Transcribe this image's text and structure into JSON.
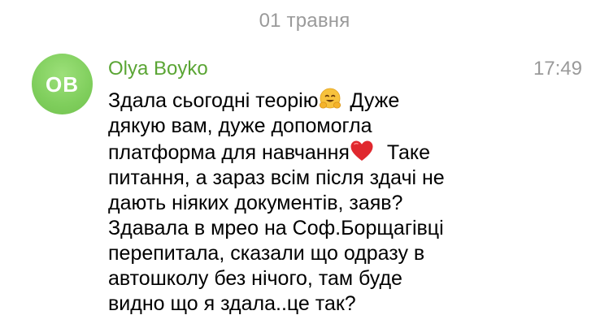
{
  "date_separator": "01 травня",
  "message": {
    "avatar_initials": "OB",
    "avatar_color": "#7fce5c",
    "sender_name": "Olya Boyko",
    "sender_color": "#5aa534",
    "time": "17:49",
    "lines": [
      {
        "before": "Здала сьогодні теорію",
        "emoji": "hugging-face-emoji",
        "after": " Дуже"
      },
      {
        "text": "дякую вам, дуже допомогла"
      },
      {
        "before": "платформа для навчання",
        "emoji": "red-heart-emoji",
        "after": "  Таке"
      },
      {
        "text": "питання, а зараз всім після здачі не"
      },
      {
        "text": "дають ніяких документів, заяв?"
      },
      {
        "text": "Здавала в мрео на Соф.Борщагівці"
      },
      {
        "text": "перепитала, сказали що одразу в"
      },
      {
        "text": "автошколу без нічого, там буде"
      },
      {
        "text": "видно що я здала..це так?"
      }
    ]
  }
}
